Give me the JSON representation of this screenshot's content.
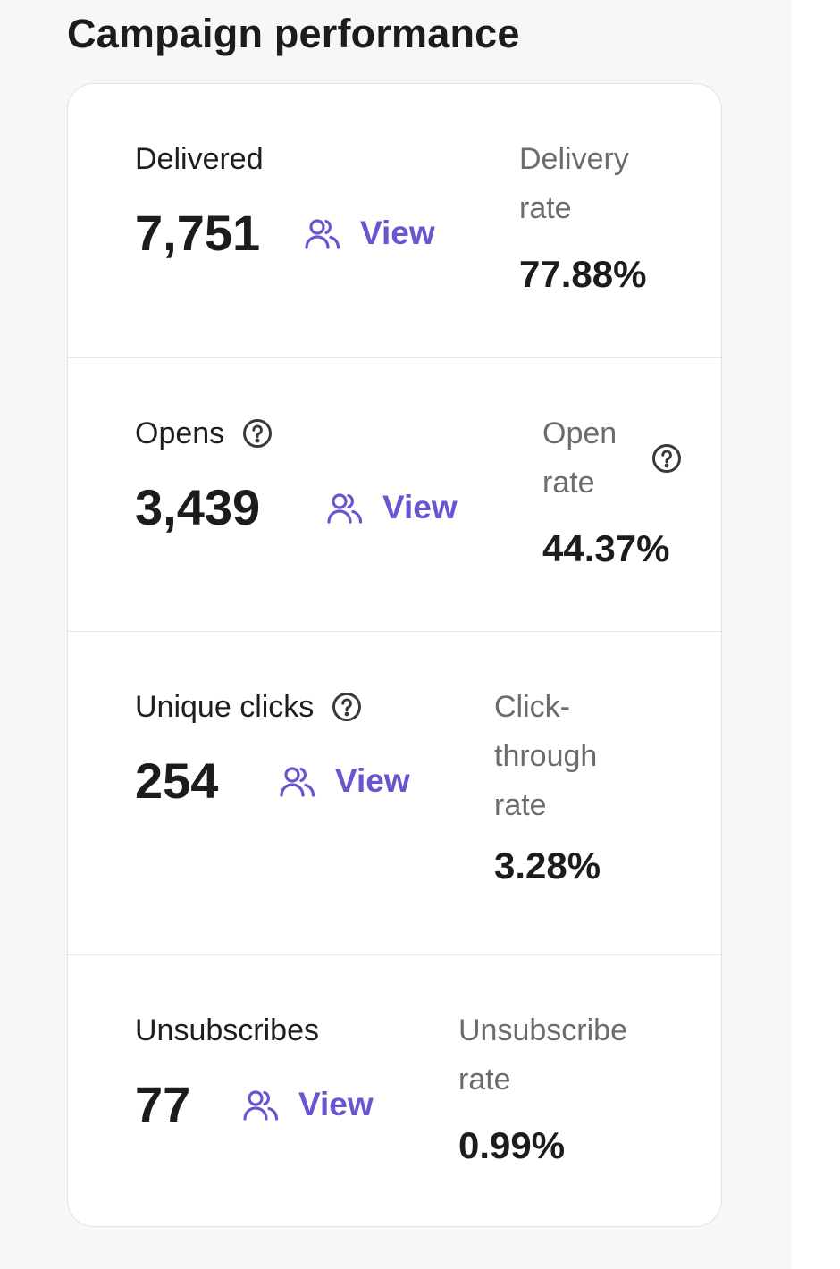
{
  "page": {
    "title": "Campaign performance"
  },
  "colors": {
    "accent": "#6a55d0",
    "panel_bg": "#f7f7f8",
    "card_border": "#e3e3e6"
  },
  "metrics": [
    {
      "label": "Delivered",
      "value": "7,751",
      "link_label": "View",
      "link_icon": "users-icon",
      "rate_label_lines": [
        "Delivery",
        "rate"
      ],
      "rate_value": "77.88%",
      "has_help": false,
      "rate_has_help": false
    },
    {
      "label": "Opens",
      "value": "3,439",
      "link_label": "View",
      "link_icon": "users-icon",
      "rate_label_lines": [
        "Open",
        "rate"
      ],
      "rate_value": "44.37%",
      "has_help": true,
      "rate_has_help": true
    },
    {
      "label": "Unique clicks",
      "value": "254",
      "link_label": "View",
      "link_icon": "users-icon",
      "rate_label_lines": [
        "Click-",
        "through",
        "rate"
      ],
      "rate_value": "3.28%",
      "has_help": true,
      "rate_has_help": false
    },
    {
      "label": "Unsubscribes",
      "value": "77",
      "link_label": "View",
      "link_icon": "users-icon",
      "rate_label_lines": [
        "Unsubscribe",
        "rate"
      ],
      "rate_value": "0.99%",
      "has_help": false,
      "rate_has_help": false
    }
  ]
}
